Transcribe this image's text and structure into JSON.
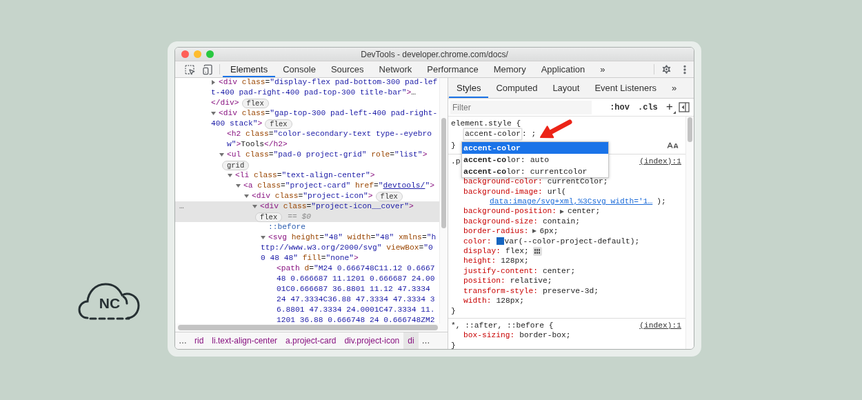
{
  "logo": {
    "text": "NC"
  },
  "window": {
    "title": "DevTools - developer.chrome.com/docs/"
  },
  "toolbar": {
    "tabs": [
      {
        "label": "Elements",
        "selected": true
      },
      {
        "label": "Console",
        "selected": false
      },
      {
        "label": "Sources",
        "selected": false
      },
      {
        "label": "Network",
        "selected": false
      },
      {
        "label": "Performance",
        "selected": false
      },
      {
        "label": "Memory",
        "selected": false
      },
      {
        "label": "Application",
        "selected": false
      }
    ],
    "overflow": "»"
  },
  "tree": [
    {
      "expanded": false,
      "selected": false,
      "lines": [
        [
          {
            "kind": "tag",
            "text": "<div"
          },
          {
            "kind": "attr",
            "text": " class"
          },
          {
            "kind": "text",
            "text": "="
          },
          {
            "kind": "value",
            "text": "\"display-flex pad-bottom-300 pad-lef"
          }
        ],
        [
          {
            "kind": "value",
            "text": "t-400 pad-right-400 pad-top-300 title-bar\""
          },
          {
            "kind": "tag",
            "text": ">"
          },
          {
            "kind": "text",
            "text": "…"
          }
        ],
        [
          {
            "kind": "tag",
            "text": "</div>"
          },
          {
            "kind": "badge",
            "text": "flex"
          }
        ]
      ]
    },
    {
      "expanded": true,
      "selected": false,
      "lines": [
        [
          {
            "kind": "tag",
            "text": "<div"
          },
          {
            "kind": "attr",
            "text": " class"
          },
          {
            "kind": "text",
            "text": "="
          },
          {
            "kind": "value",
            "text": "\"gap-top-300 pad-left-400 pad-right-"
          }
        ],
        [
          {
            "kind": "value",
            "text": "400 stack\""
          },
          {
            "kind": "tag",
            "text": ">"
          },
          {
            "kind": "badge",
            "text": "flex"
          }
        ]
      ],
      "children": [
        {
          "selected": false,
          "lines": [
            [
              {
                "kind": "tag",
                "text": "<h2"
              },
              {
                "kind": "attr",
                "text": " class"
              },
              {
                "kind": "text",
                "text": "="
              },
              {
                "kind": "value",
                "text": "\"color-secondary-text type--eyebro"
              }
            ],
            [
              {
                "kind": "value",
                "text": "w\""
              },
              {
                "kind": "tag",
                "text": ">"
              },
              {
                "kind": "text",
                "text": "Tools"
              },
              {
                "kind": "tag",
                "text": "</h2>"
              }
            ]
          ]
        },
        {
          "expanded": true,
          "selected": false,
          "lines": [
            [
              {
                "kind": "tag",
                "text": "<ul"
              },
              {
                "kind": "attr",
                "text": " class"
              },
              {
                "kind": "text",
                "text": "="
              },
              {
                "kind": "value",
                "text": "\"pad-0 project-grid\""
              },
              {
                "kind": "attr",
                "text": " role"
              },
              {
                "kind": "text",
                "text": "="
              },
              {
                "kind": "value",
                "text": "\"list\""
              },
              {
                "kind": "tag",
                "text": ">"
              }
            ],
            [
              {
                "kind": "badge",
                "text": "grid"
              }
            ]
          ],
          "children": [
            {
              "expanded": true,
              "selected": false,
              "lines": [
                [
                  {
                    "kind": "tag",
                    "text": "<li"
                  },
                  {
                    "kind": "attr",
                    "text": " class"
                  },
                  {
                    "kind": "text",
                    "text": "="
                  },
                  {
                    "kind": "value",
                    "text": "\"text-align-center\""
                  },
                  {
                    "kind": "tag",
                    "text": ">"
                  }
                ]
              ],
              "children": [
                {
                  "expanded": true,
                  "selected": false,
                  "lines": [
                    [
                      {
                        "kind": "tag",
                        "text": "<a"
                      },
                      {
                        "kind": "attr",
                        "text": " class"
                      },
                      {
                        "kind": "text",
                        "text": "="
                      },
                      {
                        "kind": "value",
                        "text": "\"project-card\""
                      },
                      {
                        "kind": "attr",
                        "text": " href"
                      },
                      {
                        "kind": "text",
                        "text": "="
                      },
                      {
                        "kind": "value",
                        "text": "\""
                      },
                      {
                        "kind": "link",
                        "text": "devtools/"
                      },
                      {
                        "kind": "value",
                        "text": "\""
                      },
                      {
                        "kind": "tag",
                        "text": ">"
                      }
                    ]
                  ],
                  "children": [
                    {
                      "expanded": true,
                      "selected": false,
                      "lines": [
                        [
                          {
                            "kind": "tag",
                            "text": "<div"
                          },
                          {
                            "kind": "attr",
                            "text": " class"
                          },
                          {
                            "kind": "text",
                            "text": "="
                          },
                          {
                            "kind": "value",
                            "text": "\"project-icon\""
                          },
                          {
                            "kind": "tag",
                            "text": ">"
                          },
                          {
                            "kind": "badge",
                            "text": "flex"
                          }
                        ]
                      ],
                      "children": [
                        {
                          "expanded": true,
                          "selected": true,
                          "gutter": "…",
                          "lines": [
                            [
                              {
                                "kind": "tag",
                                "text": "<div"
                              },
                              {
                                "kind": "attr",
                                "text": " class"
                              },
                              {
                                "kind": "text",
                                "text": "="
                              },
                              {
                                "kind": "value",
                                "text": "\"project-icon__cover\""
                              },
                              {
                                "kind": "tag",
                                "text": ">"
                              }
                            ],
                            [
                              {
                                "kind": "badge",
                                "text": "flex"
                              },
                              {
                                "kind": "dollar",
                                "text": "== $0"
                              }
                            ]
                          ],
                          "children": [
                            {
                              "selected": false,
                              "lines": [
                                [
                                  {
                                    "kind": "pseudo",
                                    "text": "::before"
                                  }
                                ]
                              ]
                            },
                            {
                              "expanded": true,
                              "selected": false,
                              "lines": [
                                [
                                  {
                                    "kind": "tag",
                                    "text": "<svg"
                                  },
                                  {
                                    "kind": "attr",
                                    "text": " height"
                                  },
                                  {
                                    "kind": "text",
                                    "text": "="
                                  },
                                  {
                                    "kind": "value",
                                    "text": "\"48\""
                                  },
                                  {
                                    "kind": "attr",
                                    "text": " width"
                                  },
                                  {
                                    "kind": "text",
                                    "text": "="
                                  },
                                  {
                                    "kind": "value",
                                    "text": "\"48\""
                                  },
                                  {
                                    "kind": "attr",
                                    "text": " xmlns"
                                  },
                                  {
                                    "kind": "text",
                                    "text": "="
                                  },
                                  {
                                    "kind": "value",
                                    "text": "\"h"
                                  }
                                ],
                                [
                                  {
                                    "kind": "value",
                                    "text": "ttp://www.w3.org/2000/svg\""
                                  },
                                  {
                                    "kind": "attr",
                                    "text": " viewBox"
                                  },
                                  {
                                    "kind": "text",
                                    "text": "="
                                  },
                                  {
                                    "kind": "value",
                                    "text": "\"0"
                                  }
                                ],
                                [
                                  {
                                    "kind": "value",
                                    "text": "0 48 48\""
                                  },
                                  {
                                    "kind": "attr",
                                    "text": " fill"
                                  },
                                  {
                                    "kind": "text",
                                    "text": "="
                                  },
                                  {
                                    "kind": "value",
                                    "text": "\"none\""
                                  },
                                  {
                                    "kind": "tag",
                                    "text": ">"
                                  }
                                ]
                              ],
                              "children": [
                                {
                                  "selected": false,
                                  "lines": [
                                    [
                                      {
                                        "kind": "tag",
                                        "text": "<path"
                                      },
                                      {
                                        "kind": "attr",
                                        "text": " d"
                                      },
                                      {
                                        "kind": "text",
                                        "text": "="
                                      },
                                      {
                                        "kind": "value",
                                        "text": "\"M24 0.666748C11.12 0.6667"
                                      }
                                    ],
                                    [
                                      {
                                        "kind": "value",
                                        "text": "48 0.666687 11.1201 0.666687 24.00"
                                      }
                                    ],
                                    [
                                      {
                                        "kind": "value",
                                        "text": "01C0.666687 36.8801 11.12 47.3334"
                                      }
                                    ],
                                    [
                                      {
                                        "kind": "value",
                                        "text": "24 47.3334C36.88 47.3334 47.3334 3"
                                      }
                                    ],
                                    [
                                      {
                                        "kind": "value",
                                        "text": "6.8801 47.3334 24.0001C47.3334 11."
                                      }
                                    ],
                                    [
                                      {
                                        "kind": "value",
                                        "text": "1201 36.88 0.666748 24 0.666748ZM2"
                                      }
                                    ]
                                  ]
                                }
                              ]
                            }
                          ]
                        }
                      ]
                    }
                  ]
                }
              ]
            }
          ]
        }
      ]
    }
  ],
  "breadcrumbs": [
    {
      "kind": "more",
      "text": "…",
      "selected": false
    },
    {
      "kind": "crumb",
      "text": "rid",
      "selected": false
    },
    {
      "kind": "crumb",
      "text": "li.text-align-center",
      "selected": false
    },
    {
      "kind": "crumb",
      "text": "a.project-card",
      "selected": false
    },
    {
      "kind": "crumb",
      "text": "div.project-icon",
      "selected": false
    },
    {
      "kind": "crumb",
      "text": "di",
      "selected": true
    },
    {
      "kind": "more",
      "text": "…",
      "selected": false
    }
  ],
  "side_tabs": {
    "tabs": [
      {
        "label": "Styles",
        "selected": true
      },
      {
        "label": "Computed",
        "selected": false
      },
      {
        "label": "Layout",
        "selected": false
      },
      {
        "label": "Event Listeners",
        "selected": false
      }
    ],
    "overflow": "»"
  },
  "filter": {
    "placeholder": "Filter",
    "hov": ":hov",
    "cls": ".cls",
    "add": "+"
  },
  "rules": [
    {
      "selector": "element.style {",
      "declarations": [
        {
          "kind": "editing",
          "property": "accent-color",
          "value": ": ;"
        }
      ],
      "close": "}"
    },
    {
      "selector": ".p",
      "source": "(index):1",
      "declarations": [
        {
          "kind": "plain",
          "property": "background-color:",
          "value": "currentColor;"
        },
        {
          "kind": "url",
          "property": "background-image:",
          "value": "url(",
          "link": "data:image/svg+xml,%3Csvg width='1…",
          "tail": ");"
        },
        {
          "kind": "expandable",
          "property": "background-position:",
          "value": "center;"
        },
        {
          "kind": "plain",
          "property": "background-size:",
          "value": "contain;"
        },
        {
          "kind": "expandable",
          "property": "border-radius:",
          "value": "6px;"
        },
        {
          "kind": "swatch",
          "property": "color:",
          "value": "var(--color-project-default);",
          "color": "#1565c0"
        },
        {
          "kind": "flex",
          "property": "display:",
          "value": "flex;"
        },
        {
          "kind": "plain",
          "property": "height:",
          "value": "128px;"
        },
        {
          "kind": "plain",
          "property": "justify-content:",
          "value": "center;"
        },
        {
          "kind": "plain",
          "property": "position:",
          "value": "relative;"
        },
        {
          "kind": "plain",
          "property": "transform-style:",
          "value": "preserve-3d;"
        },
        {
          "kind": "plain",
          "property": "width:",
          "value": "128px;"
        }
      ],
      "close": "}"
    },
    {
      "selector": "*, ::after, ::before {",
      "source": "(index):1",
      "declarations": [
        {
          "kind": "plain",
          "property": "box-sizing:",
          "value": "border-box;"
        }
      ],
      "close": "}"
    }
  ],
  "autocomplete": [
    {
      "text": "**accent-color**",
      "selected": true
    },
    {
      "text": "**accent-co**lor: auto",
      "selected": false
    },
    {
      "text": "**accent-co**lor: currentcolor",
      "selected": false
    }
  ]
}
